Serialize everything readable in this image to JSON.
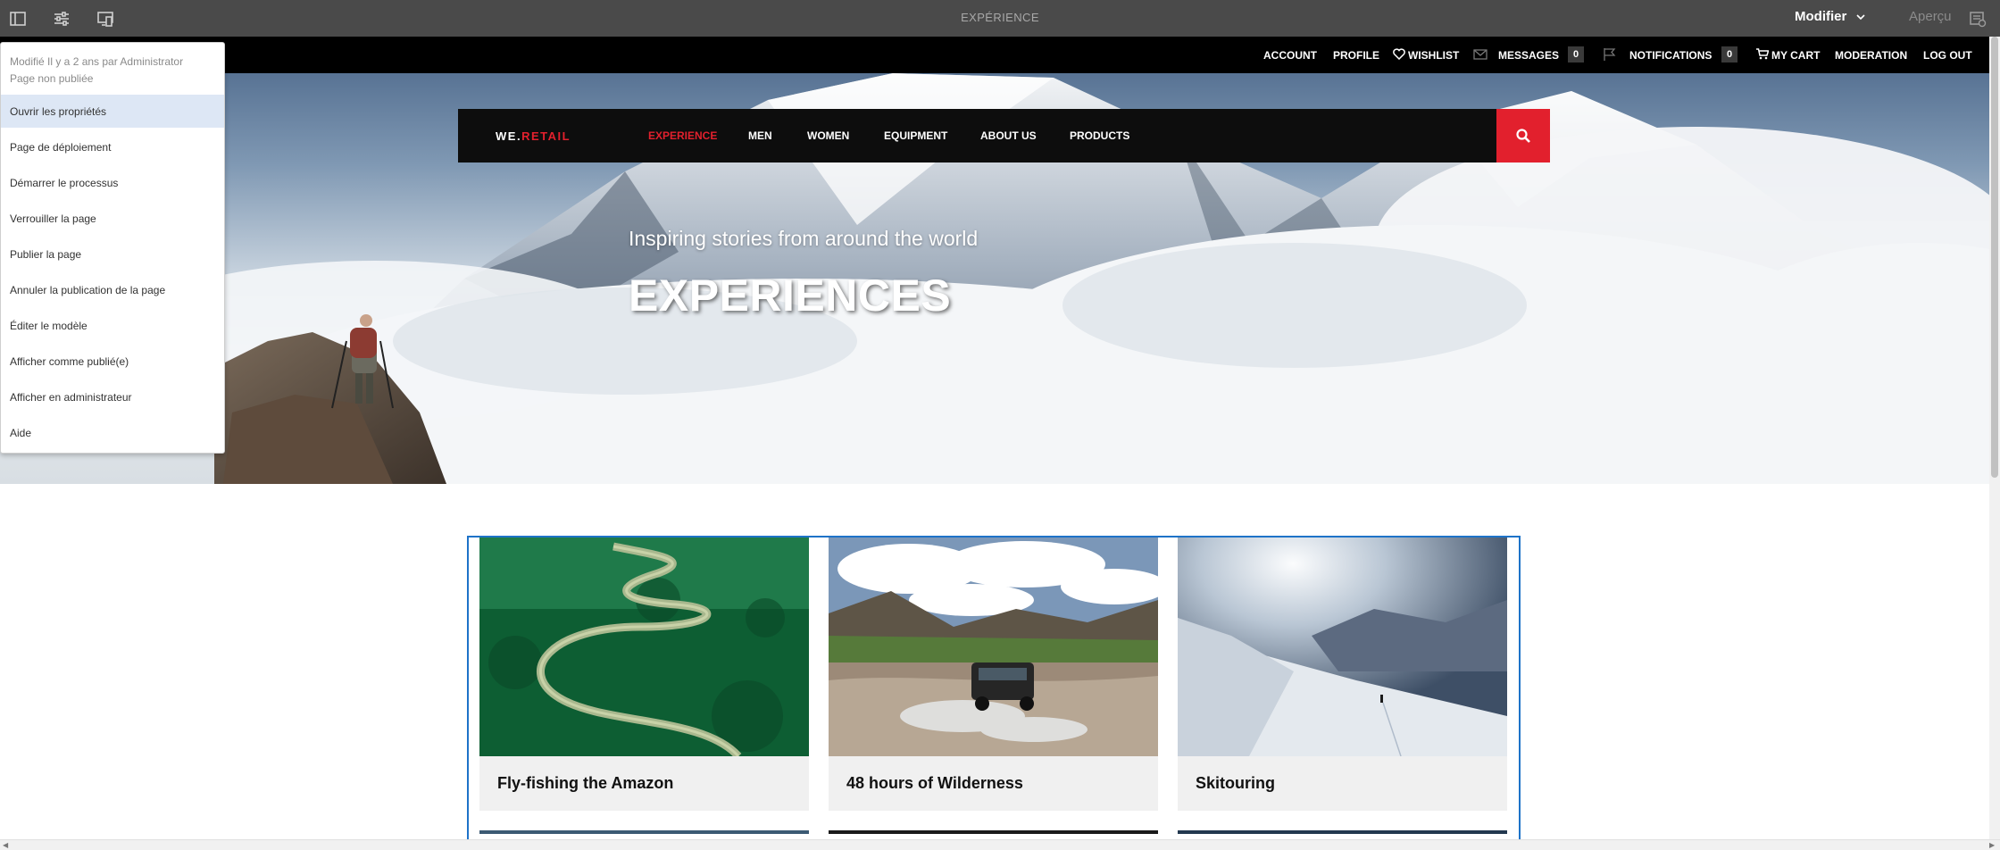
{
  "toolbar": {
    "title": "EXPÉRIENCE",
    "mode_label": "Modifier",
    "preview_label": "Aperçu",
    "icons": [
      "side-panel-icon",
      "page-properties-icon",
      "emulator-icon",
      "annotations-icon"
    ]
  },
  "page_menu": {
    "meta_modified": "Modifié Il y a 2 ans par Administrator",
    "meta_status": "Page non publiée",
    "items": [
      "Ouvrir les propriétés",
      "Page de déploiement",
      "Démarrer le processus",
      "Verrouiller la page",
      "Publier la page",
      "Annuler la publication de la page",
      "Éditer le modèle",
      "Afficher comme publié(e)",
      "Afficher en administrateur",
      "Aide"
    ],
    "highlighted_index": 0
  },
  "user_nav": {
    "account": "ACCOUNT",
    "profile": "PROFILE",
    "wishlist": "WISHLIST",
    "messages": "MESSAGES",
    "messages_count": "0",
    "notifications": "NOTIFICATIONS",
    "notifications_count": "0",
    "cart": "MY CART",
    "moderation": "MODERATION",
    "logout": "LOG OUT"
  },
  "brand": {
    "logo_prefix": "WE.",
    "logo_suffix": "RETAIL",
    "menu": [
      "EXPERIENCE",
      "MEN",
      "WOMEN",
      "EQUIPMENT",
      "ABOUT US",
      "PRODUCTS"
    ],
    "active_index": 0
  },
  "hero": {
    "subtitle": "Inspiring stories from around the world",
    "title": "EXPERIENCES"
  },
  "cards": [
    {
      "title": "Fly-fishing the Amazon"
    },
    {
      "title": "48 hours of Wilderness"
    },
    {
      "title": "Skitouring"
    }
  ],
  "colors": {
    "accent_red": "#e2202d",
    "toolbar_bg": "#4a4a4a",
    "selection_blue": "#1e73c8",
    "menu_highlight": "#dde7f5"
  }
}
